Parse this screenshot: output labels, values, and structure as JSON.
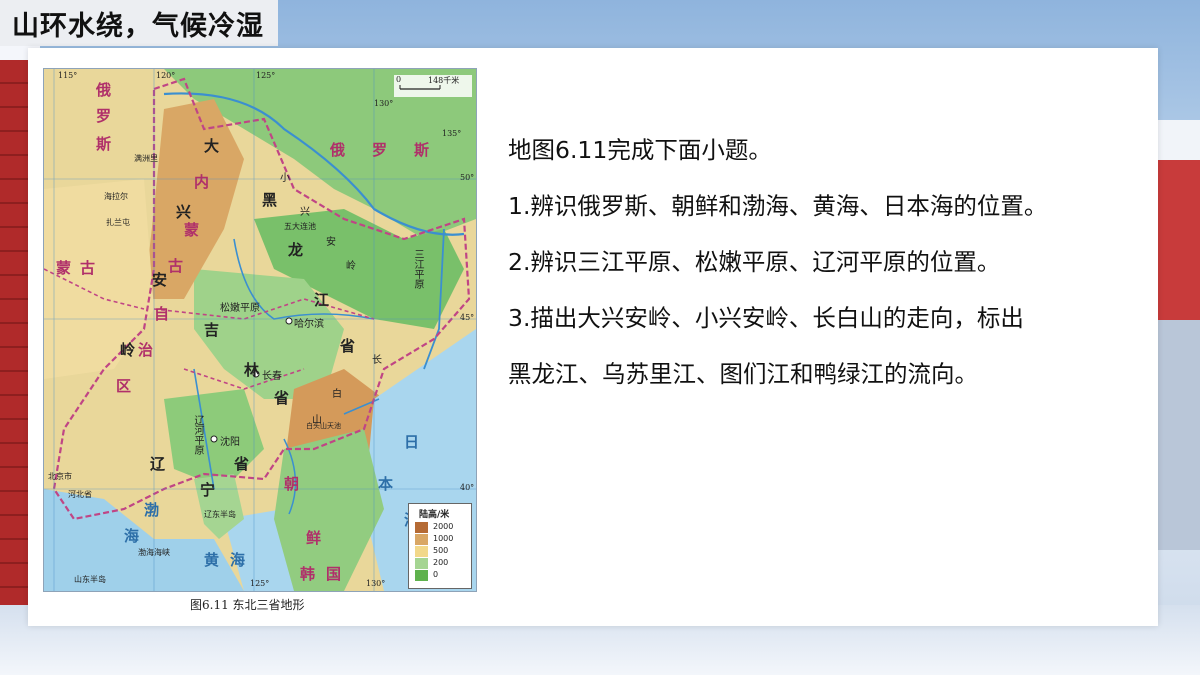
{
  "title": "山环水绕，气候冷湿",
  "colors": {
    "title_bg": "#eceef2",
    "card_bg": "#ffffff",
    "border": "#b0306a",
    "water": "#9fd0ea",
    "lowland": "#7cc46a",
    "hills": "#f2d88a",
    "mountains": "#d49a5a"
  },
  "map": {
    "caption": "图6.11  东北三省地形",
    "scale_start": "0",
    "scale_end": "148千米",
    "legend_title": "陆高/米",
    "legend_levels": [
      "2000",
      "1000",
      "500",
      "200",
      "0"
    ],
    "lon_labels": [
      "115°",
      "120°",
      "125°",
      "130°",
      "135°",
      "125°",
      "130°"
    ],
    "lat_labels": [
      "50°",
      "45°",
      "40°"
    ],
    "country_labels": [
      "俄",
      "罗",
      "斯",
      "俄",
      "罗",
      "斯",
      "蒙",
      "古",
      "朝",
      "鲜",
      "韩",
      "国",
      "日",
      "本",
      "海"
    ],
    "province_labels": [
      "黑",
      "龙",
      "江",
      "省",
      "吉",
      "林",
      "省",
      "辽",
      "宁",
      "省",
      "内",
      "蒙",
      "古",
      "自",
      "治",
      "区"
    ],
    "mountain_labels": [
      "大",
      "兴",
      "安",
      "岭",
      "小",
      "兴",
      "安",
      "岭",
      "长",
      "白",
      "山"
    ],
    "plain_labels": [
      "松嫩平原",
      "三江平原",
      "辽河平原"
    ],
    "city_labels": [
      "哈尔滨",
      "长春",
      "沈阳"
    ],
    "sea_labels": [
      "渤",
      "海",
      "黄",
      "海",
      "渤海海峡"
    ],
    "other_labels": [
      "满洲里",
      "海拉尔",
      "扎兰屯",
      "五大连池",
      "白头山天池",
      "河北省",
      "北京市",
      "辽东半岛",
      "山东半岛"
    ]
  },
  "questions": {
    "intro": "地图6.11完成下面小题。",
    "q1": "1.辨识俄罗斯、朝鲜和渤海、黄海、日本海的位置。",
    "q2": "2.辨识三江平原、松嫩平原、辽河平原的位置。",
    "q3_line1": "3.描出大兴安岭、小兴安岭、长白山的走向，标出",
    "q3_line2": "黑龙江、乌苏里江、图们江和鸭绿江的流向。"
  }
}
